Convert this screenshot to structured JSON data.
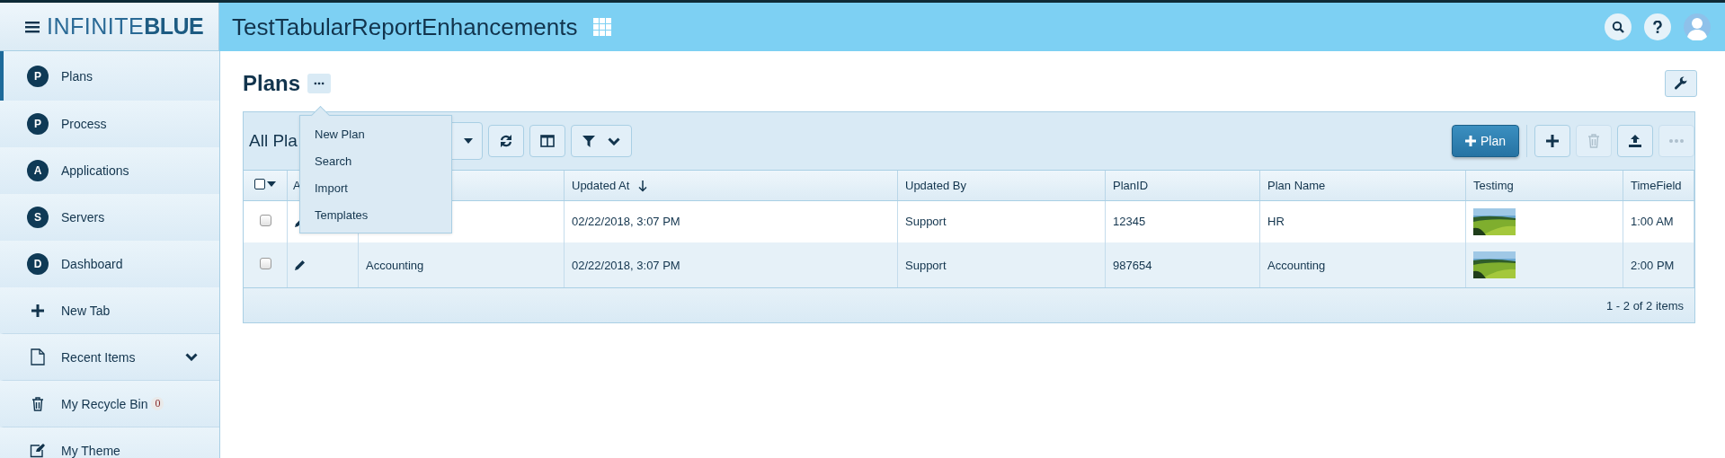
{
  "header": {
    "logo": {
      "light": "INFINITE",
      "bold": "BLUE"
    },
    "app_title": "TestTabularReportEnhancements"
  },
  "sidebar": {
    "items": [
      {
        "kind": "badge",
        "badge": "P",
        "label": "Plans",
        "selected": true
      },
      {
        "kind": "badge",
        "badge": "P",
        "label": "Process",
        "selected": false
      },
      {
        "kind": "badge",
        "badge": "A",
        "label": "Applications",
        "selected": false
      },
      {
        "kind": "badge",
        "badge": "S",
        "label": "Servers",
        "selected": false
      },
      {
        "kind": "badge",
        "badge": "D",
        "label": "Dashboard",
        "selected": false
      },
      {
        "kind": "plus",
        "label": "New Tab",
        "selected": false
      },
      {
        "kind": "document",
        "label": "Recent Items",
        "selected": false,
        "expanded": false
      },
      {
        "kind": "trash",
        "label": "My Recycle Bin",
        "selected": false,
        "count": "0"
      },
      {
        "kind": "edit",
        "label": "My Theme",
        "selected": false
      }
    ]
  },
  "page": {
    "title": "Plans",
    "menu": {
      "items": [
        "New Plan",
        "Search",
        "Import",
        "Templates"
      ]
    },
    "grid": {
      "view_label": "All Pla",
      "toolbar_buttons": [
        {
          "kind": "primary",
          "label": "Plan",
          "disabled": false
        },
        {
          "kind": "add",
          "disabled": false
        },
        {
          "kind": "delete",
          "disabled": true
        },
        {
          "kind": "export",
          "disabled": false
        },
        {
          "kind": "more",
          "disabled": true
        }
      ],
      "select_all": {
        "checked": false
      },
      "columns": [
        {
          "label": "A"
        },
        {},
        {
          "label": "Updated At",
          "sorted_descending": true
        },
        {
          "label": "Updated By"
        },
        {
          "label": "PlanID"
        },
        {
          "label": "Plan Name"
        },
        {
          "label": "Testimg"
        },
        {
          "label": "TimeField"
        }
      ],
      "rows": [
        {
          "checked": false,
          "name": null,
          "updated_at": "02/22/2018, 3:07 PM",
          "updated_by": "Support",
          "plan_id": "12345",
          "plan_name": "HR",
          "time": "1:00 AM"
        },
        {
          "checked": false,
          "name": "Accounting",
          "updated_at": "02/22/2018, 3:07 PM",
          "updated_by": "Support",
          "plan_id": "987654",
          "plan_name": "Accounting",
          "time": "2:00 PM"
        }
      ],
      "footer": "1 - 2 of 2 items"
    }
  }
}
